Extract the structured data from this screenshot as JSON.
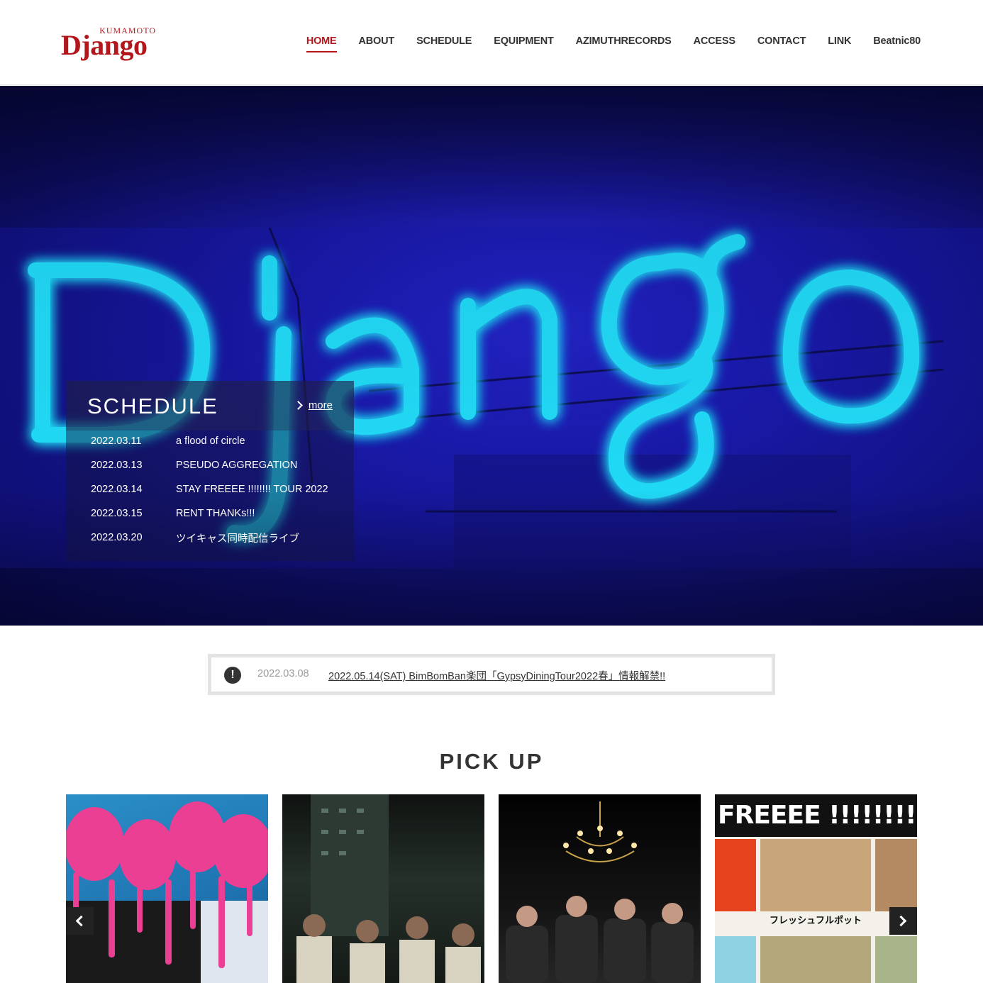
{
  "logo": {
    "top": "KUMAMOTO",
    "main": "Django"
  },
  "nav": [
    {
      "label": "HOME",
      "active": true
    },
    {
      "label": "ABOUT"
    },
    {
      "label": "SCHEDULE"
    },
    {
      "label": "EQUIPMENT"
    },
    {
      "label": "AZIMUTHRECORDS"
    },
    {
      "label": "ACCESS"
    },
    {
      "label": "CONTACT"
    },
    {
      "label": "LINK"
    },
    {
      "label": "Beatnic80"
    }
  ],
  "hero": {
    "sign_text": "Django",
    "schedule": {
      "title": "SCHEDULE",
      "more": "more",
      "items": [
        {
          "date": "2022.03.11",
          "title": "a flood of circle"
        },
        {
          "date": "2022.03.13",
          "title": "PSEUDO AGGREGATION"
        },
        {
          "date": "2022.03.14",
          "title": "STAY FREEEE !!!!!!!! TOUR 2022"
        },
        {
          "date": "2022.03.15",
          "title": "RENT THANKs!!!"
        },
        {
          "date": "2022.03.20",
          "title": "ツイキャス同時配信ライブ"
        }
      ]
    }
  },
  "news": {
    "icon": "alert-icon",
    "date": "2022.03.08",
    "text": "2022.05.14(SAT) BimBomBan楽団「GypsyDiningTour2022春」情報解禁!!"
  },
  "pickup": {
    "title": "PICK UP",
    "card4_banner": "FREEEE !!!!!!!! TOUR",
    "card4_caption": "フレッシュフルポット"
  },
  "colors": {
    "brand": "#b3171c",
    "neon": "#1fe6ff",
    "hero_bg": "#1a1aa8"
  }
}
